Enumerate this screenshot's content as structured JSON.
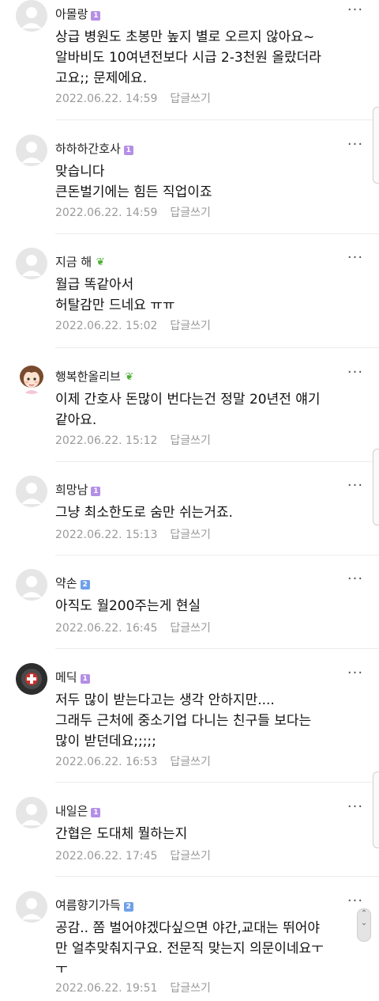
{
  "more_icon": "⋮⋯",
  "reply_label": "답글쓰기",
  "comments": [
    {
      "nick": "아몰랑",
      "badge": "1",
      "badge_type": "lvl1",
      "avatar": "default",
      "body": "상급 병원도 초봉만 높지 별로 오르지 않아요~\n알바비도 10여년전보다 시급 2-3천원 올랐더라\n고요;; 문제에요.",
      "date": "2022.06.22. 14:59"
    },
    {
      "nick": "하하하간호사",
      "badge": "1",
      "badge_type": "lvl1",
      "avatar": "default",
      "body": "맞습니다\n큰돈벌기에는 힘든 직업이죠",
      "date": "2022.06.22. 14:59"
    },
    {
      "nick": "지금 해",
      "badge": "🌱",
      "badge_type": "sprout",
      "avatar": "default",
      "body": "월급 똑같아서\n허탈감만 드네요 ㅠㅠ",
      "date": "2022.06.22. 15:02"
    },
    {
      "nick": "행복한올리브",
      "badge": "🌱",
      "badge_type": "sprout",
      "avatar": "girl",
      "body": "이제 간호사 돈많이 번다는건 정말 20년전 얘기\n같아요.",
      "date": "2022.06.22. 15:12"
    },
    {
      "nick": "희망남",
      "badge": "1",
      "badge_type": "lvl1",
      "avatar": "default",
      "body": "그냥 최소한도로 숨만 쉬는거죠.",
      "date": "2022.06.22. 15:13"
    },
    {
      "nick": "약손",
      "badge": "2",
      "badge_type": "lvl2",
      "avatar": "default",
      "body": "아직도 월200주는게 현실",
      "date": "2022.06.22. 16:45"
    },
    {
      "nick": "메딕",
      "badge": "1",
      "badge_type": "lvl1",
      "avatar": "medic",
      "body": "저두 많이 받는다고는 생각 안하지만....\n그래두 근처에 중소기업 다니는 친구들 보다는\n많이 받던데요;;;;;",
      "date": "2022.06.22. 16:53"
    },
    {
      "nick": "내일은",
      "badge": "1",
      "badge_type": "lvl1",
      "avatar": "default",
      "body": "간협은 도대체 뭘하는지",
      "date": "2022.06.22. 17:45"
    },
    {
      "nick": "여름향기가득",
      "badge": "2",
      "badge_type": "lvl2",
      "avatar": "default",
      "body": "공감.. 쫌 벌어야겠다싶으면 야간,교대는 뛰어야\n만 얼추맞춰지구요. 전문직 맞는지 의문이네요ㅜ\nㅜ",
      "date": "2022.06.22. 19:51"
    }
  ]
}
